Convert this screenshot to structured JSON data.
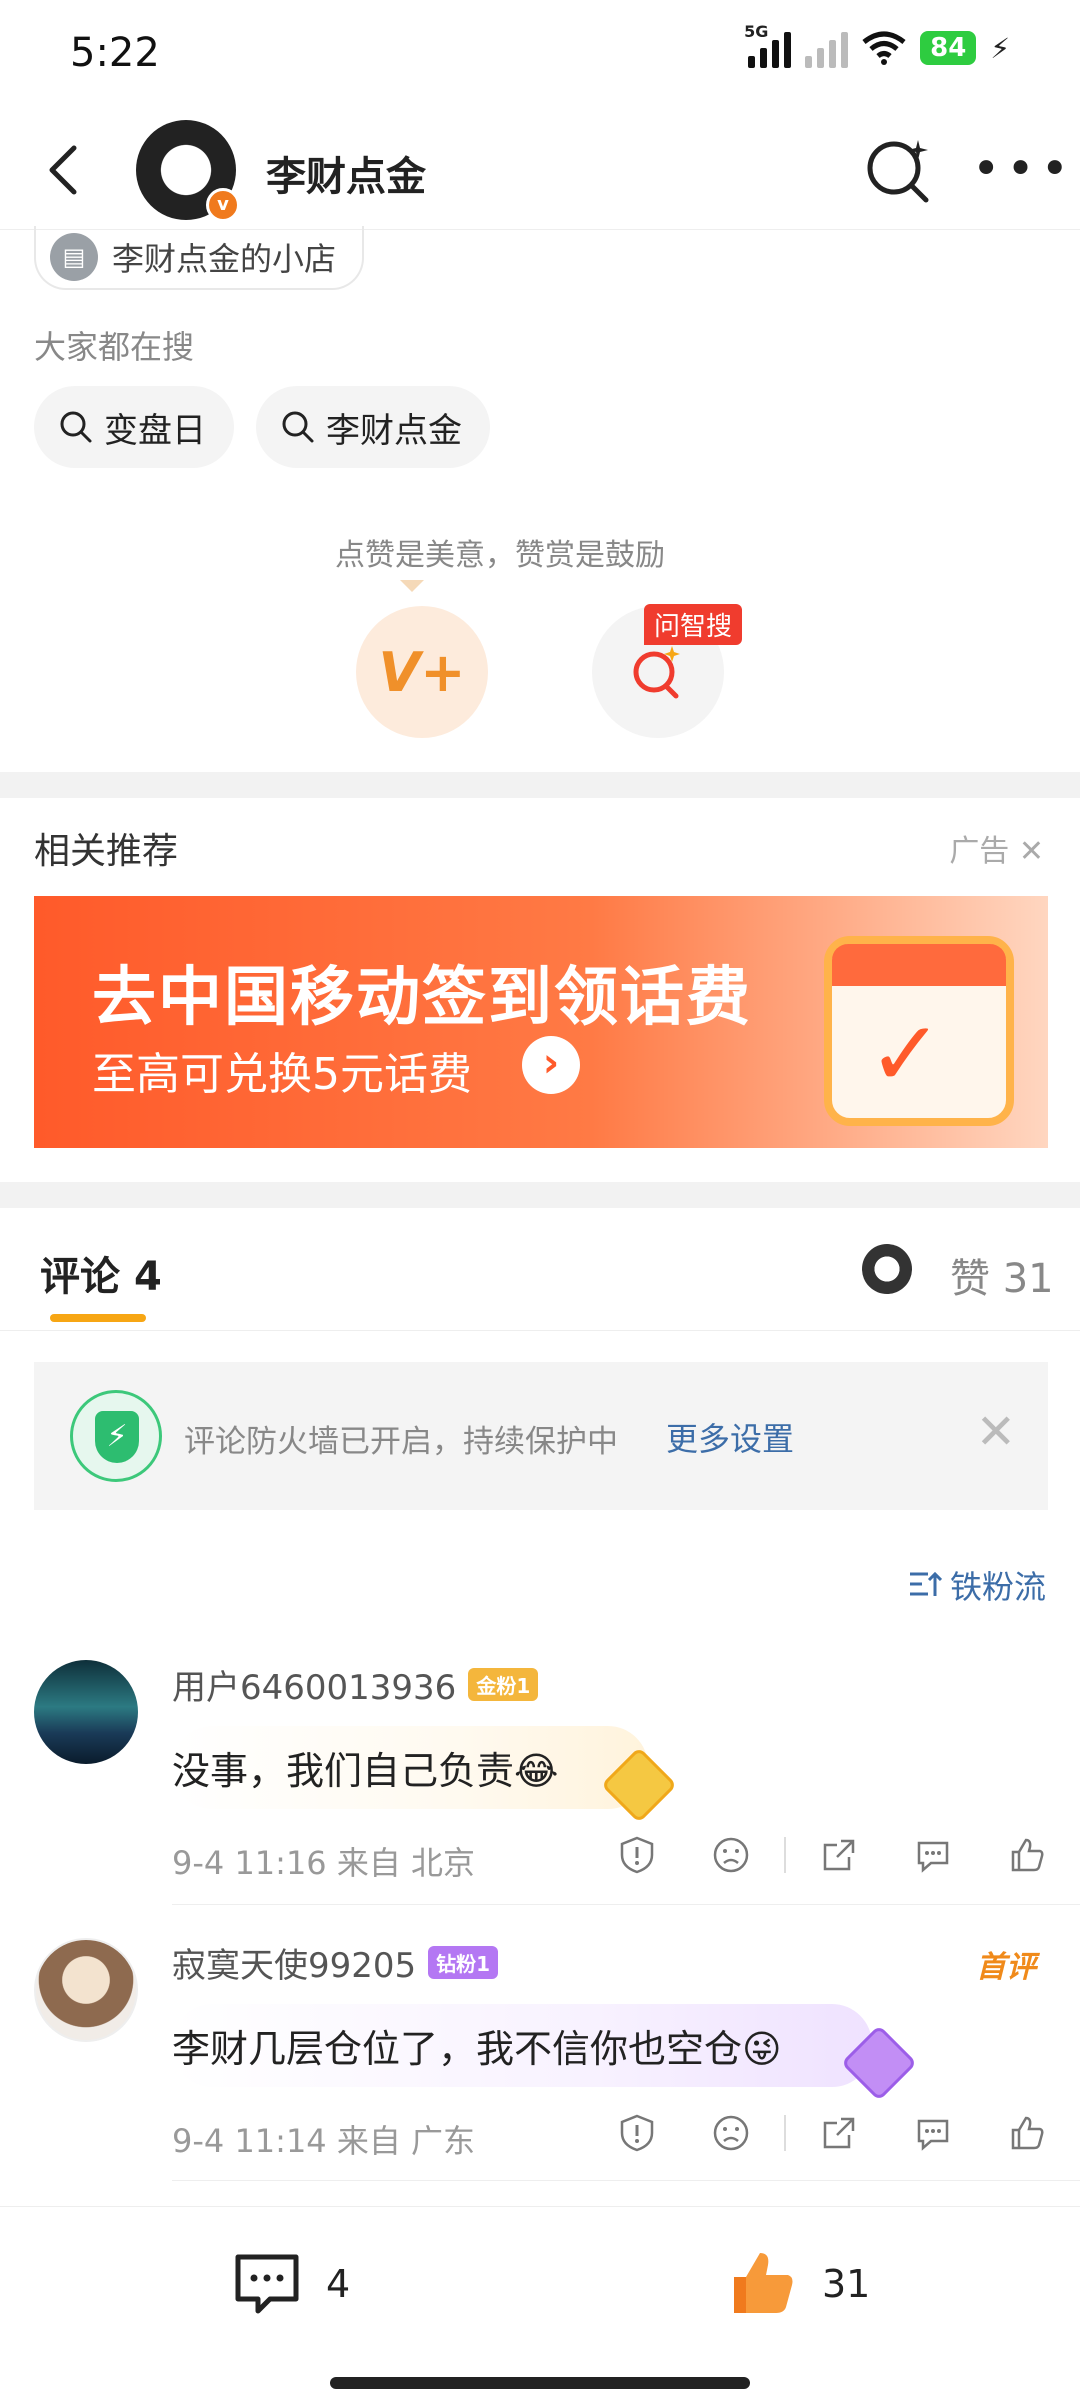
{
  "status_bar": {
    "time": "5:22",
    "network": "5G",
    "battery": "84"
  },
  "header": {
    "title": "李财点金",
    "badge": "v"
  },
  "shop": {
    "label": "李财点金的小店"
  },
  "searches": {
    "title": "大家都在搜",
    "items": [
      "变盘日",
      "李财点金"
    ]
  },
  "reward": {
    "tip": "点赞是美意，赞赏是鼓励",
    "ai_tag": "问智搜"
  },
  "recommend": {
    "title": "相关推荐",
    "ad_label": "广告"
  },
  "banner": {
    "headline": "去中国移动签到领话费",
    "subline": "至高可兑换5元话费"
  },
  "comments_section": {
    "tab_label": "评论",
    "tab_count": "4",
    "likes_label": "赞",
    "likes_count": "31"
  },
  "firewall": {
    "text": "评论防火墙已开启，持续保护中",
    "link": "更多设置"
  },
  "sort": {
    "label": "铁粉流"
  },
  "comments": [
    {
      "user": "用户6460013936",
      "fan_badge": "金粉1",
      "text": "没事，我们自己负责😂",
      "time": "9-4 11:16",
      "location": "来自 北京"
    },
    {
      "user": "寂寞天使99205",
      "fan_badge": "钻粉1",
      "text": "李财几层仓位了，我不信你也空仓😜",
      "time": "9-4 11:14",
      "location": "来自 广东",
      "tag": "首评"
    }
  ],
  "bottom_bar": {
    "comment_count": "4",
    "like_count": "31"
  },
  "colors": {
    "accent_orange": "#f7a614",
    "link_blue": "#3c6da8",
    "ad_red": "#ff5a2a",
    "battery_green": "#2ecc40"
  }
}
